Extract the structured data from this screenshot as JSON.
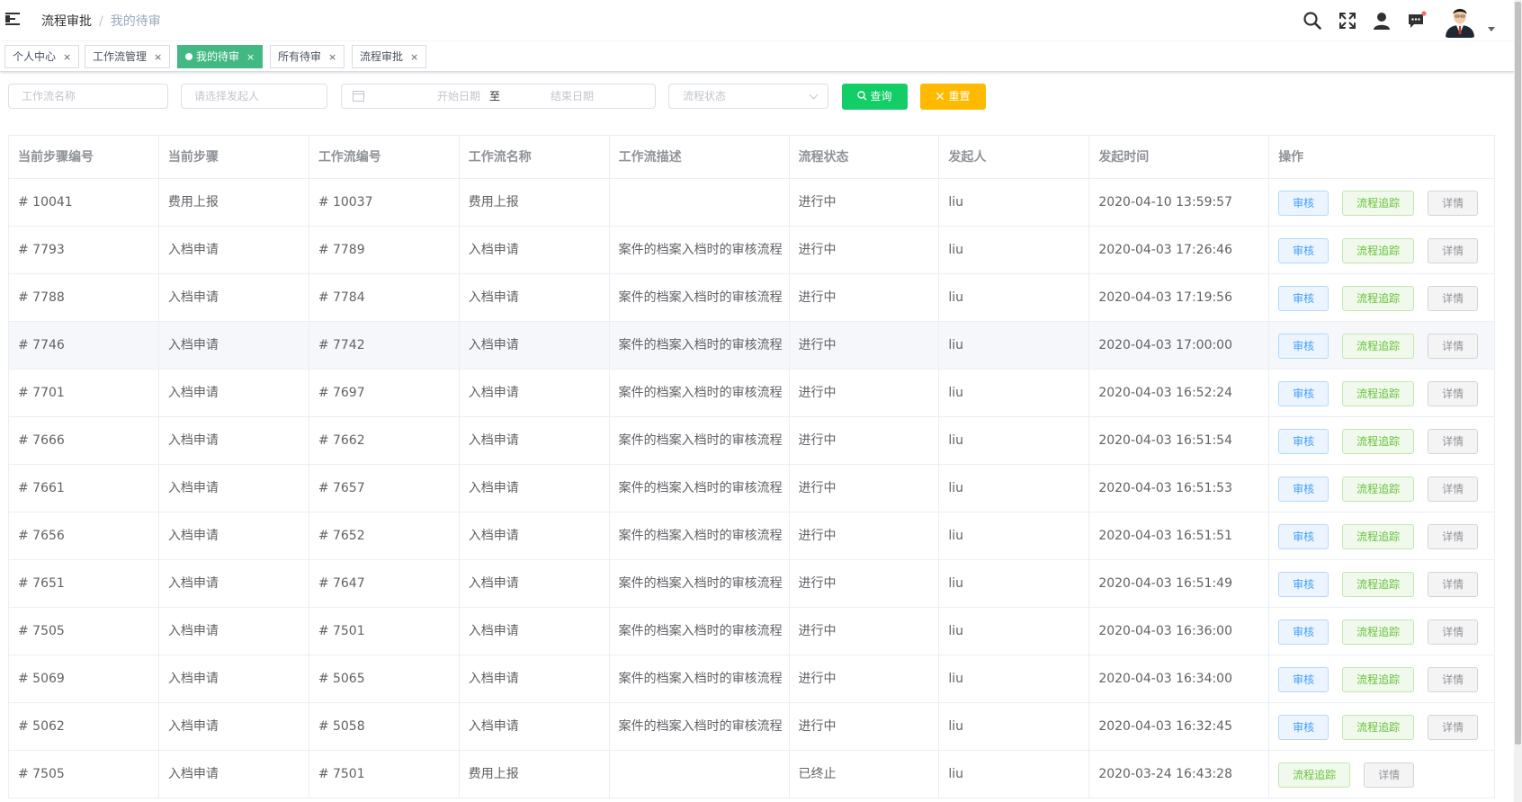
{
  "breadcrumb": {
    "parent": "流程审批",
    "separator": "/",
    "current": "我的待审"
  },
  "tags": [
    {
      "label": "个人中心",
      "close": "×"
    },
    {
      "label": "工作流管理",
      "close": "×"
    },
    {
      "label": "我的待审",
      "close": "×",
      "active": true
    },
    {
      "label": "所有待审",
      "close": "×"
    },
    {
      "label": "流程审批",
      "close": "×"
    }
  ],
  "filters": {
    "workflow_name_placeholder": "工作流名称",
    "initiator_placeholder": "请选择发起人",
    "start_date_placeholder": "开始日期",
    "range_separator": "至",
    "end_date_placeholder": "结束日期",
    "status_placeholder": "流程状态",
    "search_label": "查询",
    "reset_label": "重置"
  },
  "table": {
    "columns": [
      "当前步骤编号",
      "当前步骤",
      "工作流编号",
      "工作流名称",
      "工作流描述",
      "流程状态",
      "发起人",
      "发起时间",
      "操作"
    ],
    "actions": {
      "audit": "审核",
      "trace": "流程追踪",
      "detail": "详情"
    },
    "rows": [
      {
        "step_no": "# 10041",
        "step": "费用上报",
        "wf_no": "# 10037",
        "wf_name": "费用上报",
        "desc": "",
        "status": "进行中",
        "initiator": "liu",
        "time": "2020-04-10 13:59:57"
      },
      {
        "step_no": "# 7793",
        "step": "入档申请",
        "wf_no": "# 7789",
        "wf_name": "入档申请",
        "desc": "案件的档案入档时的审核流程",
        "status": "进行中",
        "initiator": "liu",
        "time": "2020-04-03 17:26:46"
      },
      {
        "step_no": "# 7788",
        "step": "入档申请",
        "wf_no": "# 7784",
        "wf_name": "入档申请",
        "desc": "案件的档案入档时的审核流程",
        "status": "进行中",
        "initiator": "liu",
        "time": "2020-04-03 17:19:56"
      },
      {
        "step_no": "# 7746",
        "step": "入档申请",
        "wf_no": "# 7742",
        "wf_name": "入档申请",
        "desc": "案件的档案入档时的审核流程",
        "status": "进行中",
        "initiator": "liu",
        "time": "2020-04-03 17:00:00"
      },
      {
        "step_no": "# 7701",
        "step": "入档申请",
        "wf_no": "# 7697",
        "wf_name": "入档申请",
        "desc": "案件的档案入档时的审核流程",
        "status": "进行中",
        "initiator": "liu",
        "time": "2020-04-03 16:52:24"
      },
      {
        "step_no": "# 7666",
        "step": "入档申请",
        "wf_no": "# 7662",
        "wf_name": "入档申请",
        "desc": "案件的档案入档时的审核流程",
        "status": "进行中",
        "initiator": "liu",
        "time": "2020-04-03 16:51:54"
      },
      {
        "step_no": "# 7661",
        "step": "入档申请",
        "wf_no": "# 7657",
        "wf_name": "入档申请",
        "desc": "案件的档案入档时的审核流程",
        "status": "进行中",
        "initiator": "liu",
        "time": "2020-04-03 16:51:53"
      },
      {
        "step_no": "# 7656",
        "step": "入档申请",
        "wf_no": "# 7652",
        "wf_name": "入档申请",
        "desc": "案件的档案入档时的审核流程",
        "status": "进行中",
        "initiator": "liu",
        "time": "2020-04-03 16:51:51"
      },
      {
        "step_no": "# 7651",
        "step": "入档申请",
        "wf_no": "# 7647",
        "wf_name": "入档申请",
        "desc": "案件的档案入档时的审核流程",
        "status": "进行中",
        "initiator": "liu",
        "time": "2020-04-03 16:51:49"
      },
      {
        "step_no": "# 7505",
        "step": "入档申请",
        "wf_no": "# 7501",
        "wf_name": "入档申请",
        "desc": "案件的档案入档时的审核流程",
        "status": "进行中",
        "initiator": "liu",
        "time": "2020-04-03 16:36:00"
      },
      {
        "step_no": "# 5069",
        "step": "入档申请",
        "wf_no": "# 5065",
        "wf_name": "入档申请",
        "desc": "案件的档案入档时的审核流程",
        "status": "进行中",
        "initiator": "liu",
        "time": "2020-04-03 16:34:00"
      },
      {
        "step_no": "# 5062",
        "step": "入档申请",
        "wf_no": "# 5058",
        "wf_name": "入档申请",
        "desc": "案件的档案入档时的审核流程",
        "status": "进行中",
        "initiator": "liu",
        "time": "2020-04-03 16:32:45"
      },
      {
        "step_no": "# 7505",
        "step": "入档申请",
        "wf_no": "# 7501",
        "wf_name": "费用上报",
        "desc": "",
        "status": "已终止",
        "initiator": "liu",
        "time": "2020-03-24 16:43:28",
        "no_audit": true
      }
    ]
  },
  "icons": [
    "hamburger-icon",
    "search-icon",
    "fullscreen-icon",
    "user-icon",
    "message-icon",
    "calendar-icon",
    "chevron-down-icon"
  ],
  "colors": {
    "tag_active": "#42b983",
    "search_button": "#13ce66",
    "reset_button": "#ffba00",
    "audit": "#409eff",
    "trace": "#67c23a"
  }
}
